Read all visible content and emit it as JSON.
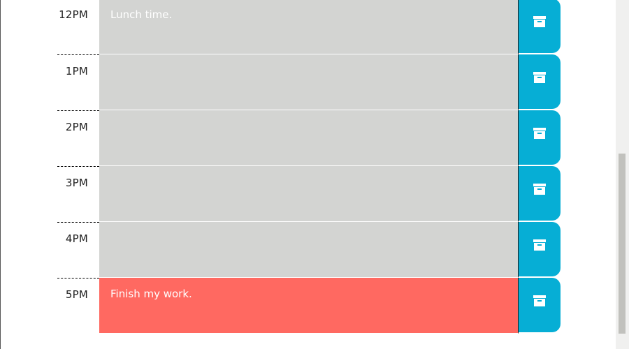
{
  "colors": {
    "past": "#d3d4d2",
    "present": "#ff6961",
    "save_button": "#06aed5"
  },
  "schedule": {
    "rows": [
      {
        "hour": "12PM",
        "description": "Lunch time.",
        "state": "past",
        "icon": "save-icon"
      },
      {
        "hour": "1PM",
        "description": "",
        "state": "past",
        "icon": "save-icon"
      },
      {
        "hour": "2PM",
        "description": "",
        "state": "past",
        "icon": "save-icon"
      },
      {
        "hour": "3PM",
        "description": "",
        "state": "past",
        "icon": "save-icon"
      },
      {
        "hour": "4PM",
        "description": "",
        "state": "past",
        "icon": "save-icon"
      },
      {
        "hour": "5PM",
        "description": "Finish my work.",
        "state": "present",
        "icon": "save-icon"
      }
    ]
  }
}
